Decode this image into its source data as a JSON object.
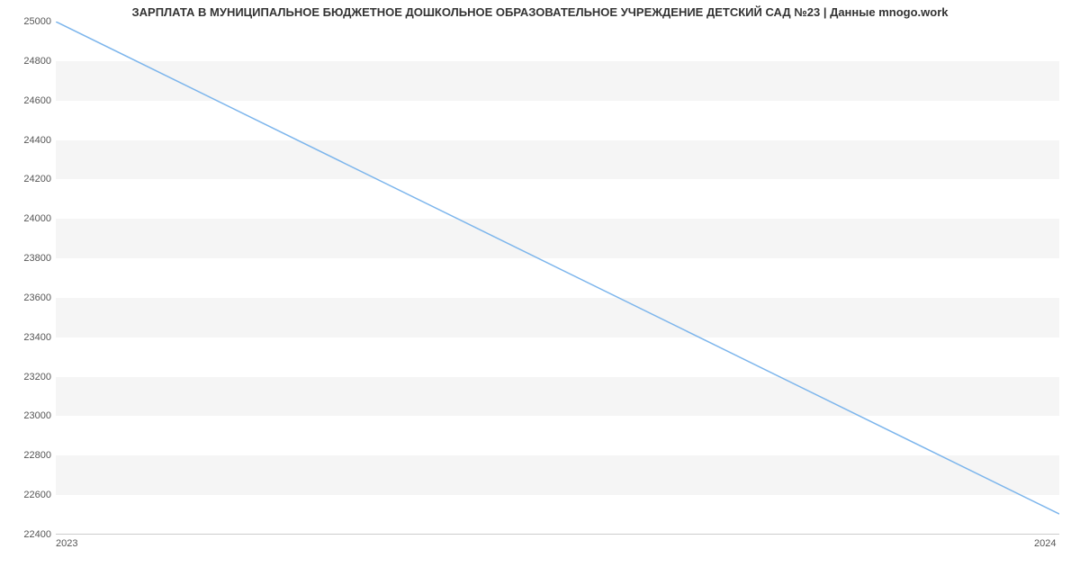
{
  "chart_data": {
    "type": "line",
    "title": "ЗАРПЛАТА В МУНИЦИПАЛЬНОЕ БЮДЖЕТНОЕ ДОШКОЛЬНОЕ ОБРАЗОВАТЕЛЬНОЕ УЧРЕЖДЕНИЕ ДЕТСКИЙ САД №23 | Данные mnogo.work",
    "x": [
      2023,
      2024
    ],
    "values": [
      25000,
      22500
    ],
    "xlabel": "",
    "ylabel": "",
    "ylim": [
      22400,
      25000
    ],
    "y_ticks": [
      22400,
      22600,
      22800,
      23000,
      23200,
      23400,
      23600,
      23800,
      24000,
      24200,
      24400,
      24600,
      24800,
      25000
    ],
    "x_ticks": [
      "2023",
      "2024"
    ],
    "line_color": "#7cb5ec",
    "band_color": "#f5f5f5"
  }
}
